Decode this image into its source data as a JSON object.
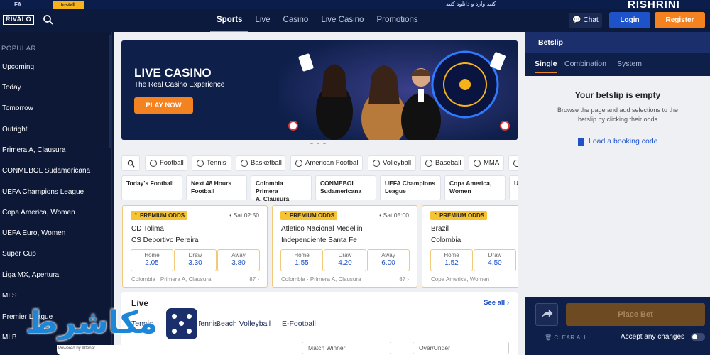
{
  "promo_strip": {
    "left_text": "FA",
    "chip_label": "Install",
    "right_text": "کنید وارد و دانلود کنید",
    "brand": "RISHRINI"
  },
  "header": {
    "logo": "RIVALO",
    "nav": [
      "Sports",
      "Live",
      "Casino",
      "Live Casino",
      "Promotions"
    ],
    "active_nav": "Sports",
    "chat_label": "Chat",
    "login_label": "Login",
    "register_label": "Register"
  },
  "sidebar": {
    "section": "POPULAR",
    "items": [
      "Upcoming",
      "Today",
      "Tomorrow",
      "Outright",
      "Primera A, Clausura",
      "CONMEBOL Sudamericana",
      "UEFA Champions League",
      "Copa America, Women",
      "UEFA Euro, Women",
      "Super Cup",
      "Liga MX, Apertura",
      "MLS",
      "Premier League",
      "MLB"
    ]
  },
  "banner": {
    "title": "LIVE CASINO",
    "subtitle": "The Real Casino Experience",
    "cta": "PLAY NOW"
  },
  "sports_filters": [
    "Football",
    "Tennis",
    "Basketball",
    "American Football",
    "Volleyball",
    "Baseball",
    "MMA",
    ""
  ],
  "league_tabs": [
    [
      "Today's Football",
      ""
    ],
    [
      "Next 48 Hours",
      "Football"
    ],
    [
      "Colombia Primera",
      "A, Clausura"
    ],
    [
      "CONMEBOL",
      "Sudamericana"
    ],
    [
      "UEFA Champions",
      "League"
    ],
    [
      "Copa America,",
      "Women"
    ],
    [
      "U",
      ""
    ]
  ],
  "matches": [
    {
      "badge": "PREMIUM ODDS",
      "time": "Sat 02:50",
      "home": "CD Tolima",
      "away": "CS Deportivo Pereira",
      "odds": [
        {
          "label": "Home",
          "value": "2.05"
        },
        {
          "label": "Draw",
          "value": "3.30"
        },
        {
          "label": "Away",
          "value": "3.80"
        }
      ],
      "league": "Colombia · Primera A, Clausura",
      "markets": "87"
    },
    {
      "badge": "PREMIUM ODDS",
      "time": "Sat 05:00",
      "home": "Atletico Nacional Medellin",
      "away": "Independiente Santa Fe",
      "odds": [
        {
          "label": "Home",
          "value": "1.55"
        },
        {
          "label": "Draw",
          "value": "4.20"
        },
        {
          "label": "Away",
          "value": "6.00"
        }
      ],
      "league": "Colombia · Primera A, Clausura",
      "markets": "87"
    },
    {
      "badge": "PREMIUM ODDS",
      "time": "",
      "home": "Brazil",
      "away": "Colombia",
      "odds": [
        {
          "label": "Home",
          "value": "1.52"
        },
        {
          "label": "Draw",
          "value": "4.50"
        },
        {
          "label": "Away",
          "value": ""
        }
      ],
      "league": "Copa America, Women",
      "markets": ""
    }
  ],
  "live": {
    "title": "Live",
    "see_all": "See all",
    "tabs": [
      "Tennis",
      "Tennis",
      "Beach Volleyball",
      "E-Football"
    ],
    "filters": [
      "Match Winner",
      "Over/Under"
    ]
  },
  "betslip": {
    "title": "Betslip",
    "tabs": [
      "Single",
      "Combination",
      "System"
    ],
    "empty_title": "Your betslip is empty",
    "empty_desc": "Browse the page and add selections to the betslip by clicking their odds",
    "booking": "Load a booking code",
    "place_bet": "Place Bet",
    "clear_all": "CLEAR ALL",
    "accept_changes": "Accept any changes"
  },
  "watermark": {
    "arabic": "مکاشرط",
    "powered": "Powered by Altenar"
  },
  "colors": {
    "accent": "#f58220",
    "primary": "#1e52c8",
    "navy": "#0e1f4a"
  }
}
